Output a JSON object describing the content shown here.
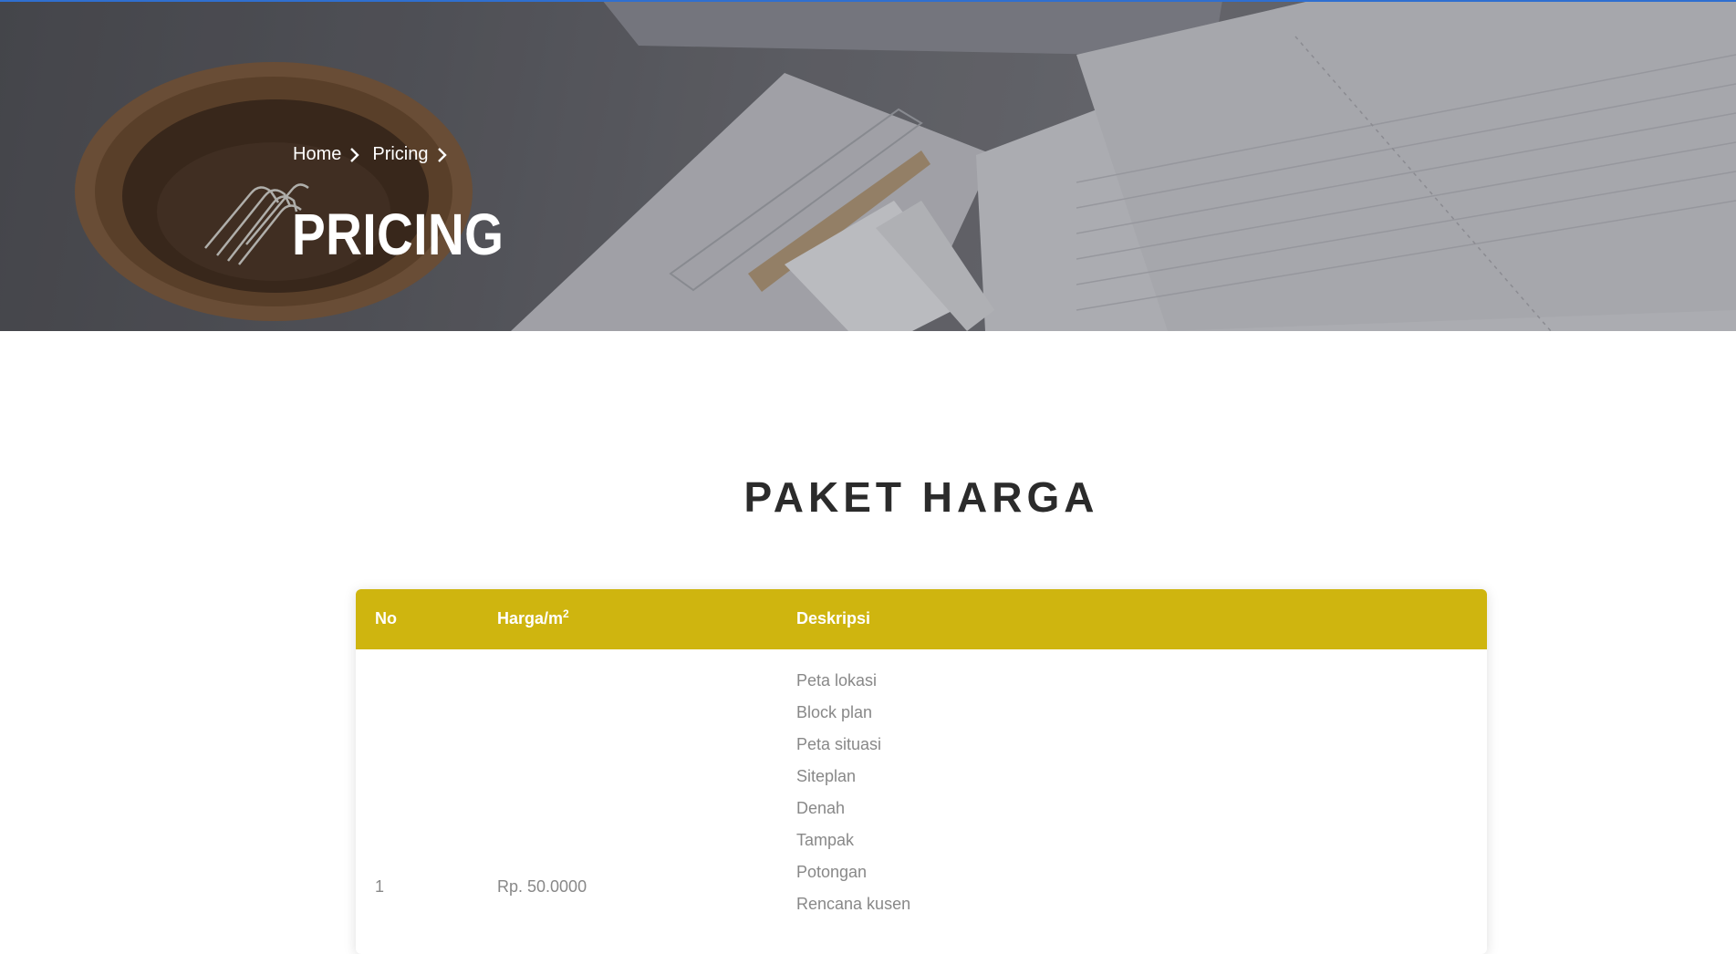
{
  "breadcrumb": {
    "items": [
      {
        "label": "Home"
      },
      {
        "label": "Pricing"
      }
    ],
    "separator_icon": "chevron-right-icon"
  },
  "page_title": "PRICING",
  "section_title": "PAKET HARGA",
  "table": {
    "columns": {
      "no": "No",
      "harga_prefix": "Harga/m",
      "harga_sup": "2",
      "deskripsi": "Deskripsi"
    },
    "rows": [
      {
        "no": "1",
        "harga": "Rp. 50.0000",
        "deskripsi": [
          "Peta lokasi",
          "Block plan",
          "Peta situasi",
          "Siteplan",
          "Denah",
          "Tampak",
          "Potongan",
          "Rencana kusen"
        ]
      }
    ]
  },
  "colors": {
    "table_header": "#cfb50f",
    "top_accent_line": "#2f6fd0",
    "heading_text": "#2b2b2b",
    "cell_text": "#888888"
  }
}
